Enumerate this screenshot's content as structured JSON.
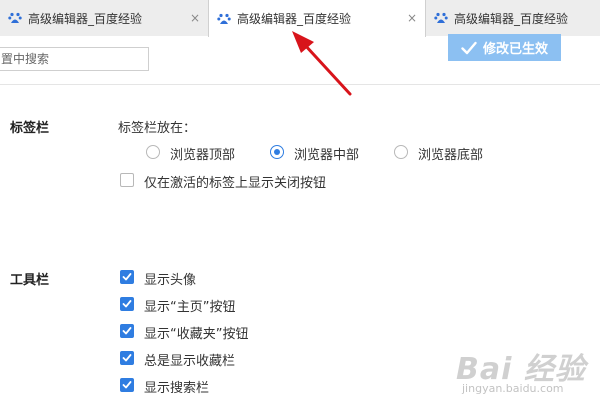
{
  "tabs": [
    {
      "title": "高级编辑器_百度经验",
      "close": "×"
    },
    {
      "title": "高级编辑器_百度经验",
      "close": "×"
    },
    {
      "title": "高级编辑器_百度经验"
    }
  ],
  "toolbar": {
    "search_text": "置中搜索",
    "apply_label": "修改已生效"
  },
  "tabbar_section": {
    "title": "标签栏",
    "position_label": "标签栏放在：",
    "options": [
      {
        "label": "浏览器顶部",
        "selected": false
      },
      {
        "label": "浏览器中部",
        "selected": true
      },
      {
        "label": "浏览器底部",
        "selected": false
      }
    ],
    "close_button_only_active": {
      "label": "仅在激活的标签上显示关闭按钮",
      "checked": false
    }
  },
  "toolbar_section": {
    "title": "工具栏",
    "items": [
      {
        "label": "显示头像",
        "checked": true
      },
      {
        "label": "显示“主页”按钮",
        "checked": true
      },
      {
        "label": "显示“收藏夹”按钮",
        "checked": true
      },
      {
        "label": "总是显示收藏栏",
        "checked": true
      },
      {
        "label": "显示搜索栏",
        "checked": true
      }
    ]
  },
  "watermark": {
    "logo_text": "Bai 经验",
    "url": "jingyan.baidu.com"
  },
  "colors": {
    "accent": "#2f7de1",
    "apply_button": "#8cc0f2",
    "annotation_arrow": "#d8141b"
  }
}
